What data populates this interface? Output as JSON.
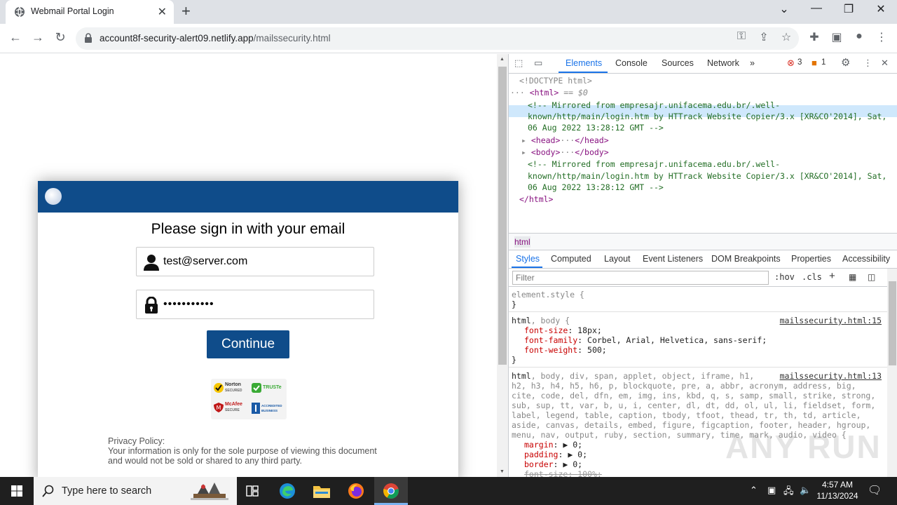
{
  "browser": {
    "tab_title": "Webmail Portal Login",
    "url_domain": "account8f-security-alert09.netlify.app",
    "url_path": "/mailssecurity.html"
  },
  "login": {
    "heading": "Please sign in with your email",
    "email_value": "test@server.com",
    "password_value": "•••••••••••",
    "continue_label": "Continue",
    "badges": {
      "norton": "Norton",
      "norton_sub": "SECURED",
      "truste": "TRUSTe",
      "mcafee": "McAfee",
      "mcafee_sub": "SECURE",
      "bbb_a": "ACCREDITED",
      "bbb_b": "BUSINESS"
    },
    "privacy_title": "Privacy Policy:",
    "privacy_line1": "Your information is only for the sole purpose of viewing this document",
    "privacy_line2": "and would not be sold or shared to any third party."
  },
  "devtools": {
    "tabs": [
      "Elements",
      "Console",
      "Sources",
      "Network"
    ],
    "more": "»",
    "error_count": "3",
    "warning_count": "1",
    "dom": {
      "doctype": "<!DOCTYPE html>",
      "html_open": "<html>",
      "selected_marker": "== $0",
      "comment1_a": "<!-- Mirrored from empresajr.unifacema.edu.br/.well-",
      "comment1_b": "known/http/main/login.htm by HTTrack Website Copier/3.x [XR&CO'2014], Sat,",
      "comment1_c": "06 Aug 2022 13:28:12 GMT -->",
      "head": "<head>",
      "head_close": "</head>",
      "body": "<body>",
      "body_close": "</body>",
      "ellipsis": "···",
      "html_close": "</html>"
    },
    "breadcrumb": "html",
    "style_tabs": [
      "Styles",
      "Computed",
      "Layout",
      "Event Listeners",
      "DOM Breakpoints",
      "Properties",
      "Accessibility"
    ],
    "filter_placeholder": "Filter",
    "hov": ":hov",
    "cls": ".cls",
    "rules": {
      "element_style": "element.style {",
      "close": "}",
      "r1_selector_main": "html",
      "r1_selector_rest": ", body {",
      "r1_source": "mailssecurity.html:15",
      "r1_props": [
        {
          "name": "font-size",
          "value": "18px;"
        },
        {
          "name": "font-family",
          "value": "Corbel, Arial, Helvetica, sans-serif;"
        },
        {
          "name": "font-weight",
          "value": "500;"
        }
      ],
      "r2_selector_main": "html",
      "r2_source": "mailssecurity.html:13",
      "r2_selector_lines": [
        ", body, div, span, applet, object, iframe, h1,",
        "h2, h3, h4, h5, h6, p, blockquote, pre, a, abbr, acronym, address, big,",
        "cite, code, del, dfn, em, img, ins, kbd, q, s, samp, small, strike, strong,",
        "sub, sup, tt, var, b, u, i, center, dl, dt, dd, ol, ul, li, fieldset, form,",
        "label, legend, table, caption, tbody, tfoot, thead, tr, th, td, article,",
        "aside, canvas, details, embed, figure, figcaption, footer, header, hgroup,",
        "menu, nav, output, ruby, section, summary, time, mark, audio, video {"
      ],
      "r2_props": [
        {
          "name": "margin",
          "value": "▶ 0;"
        },
        {
          "name": "padding",
          "value": "▶ 0;"
        },
        {
          "name": "border",
          "value": "▶ 0;"
        },
        {
          "name": "font-size",
          "value": "100%;"
        }
      ]
    }
  },
  "taskbar": {
    "search_placeholder": "Type here to search",
    "time": "4:57 AM",
    "date": "11/13/2024"
  },
  "watermark": "ANY RUN",
  "colors": {
    "brand_blue": "#0f4c8a",
    "devtools_accent": "#1a73e8"
  }
}
